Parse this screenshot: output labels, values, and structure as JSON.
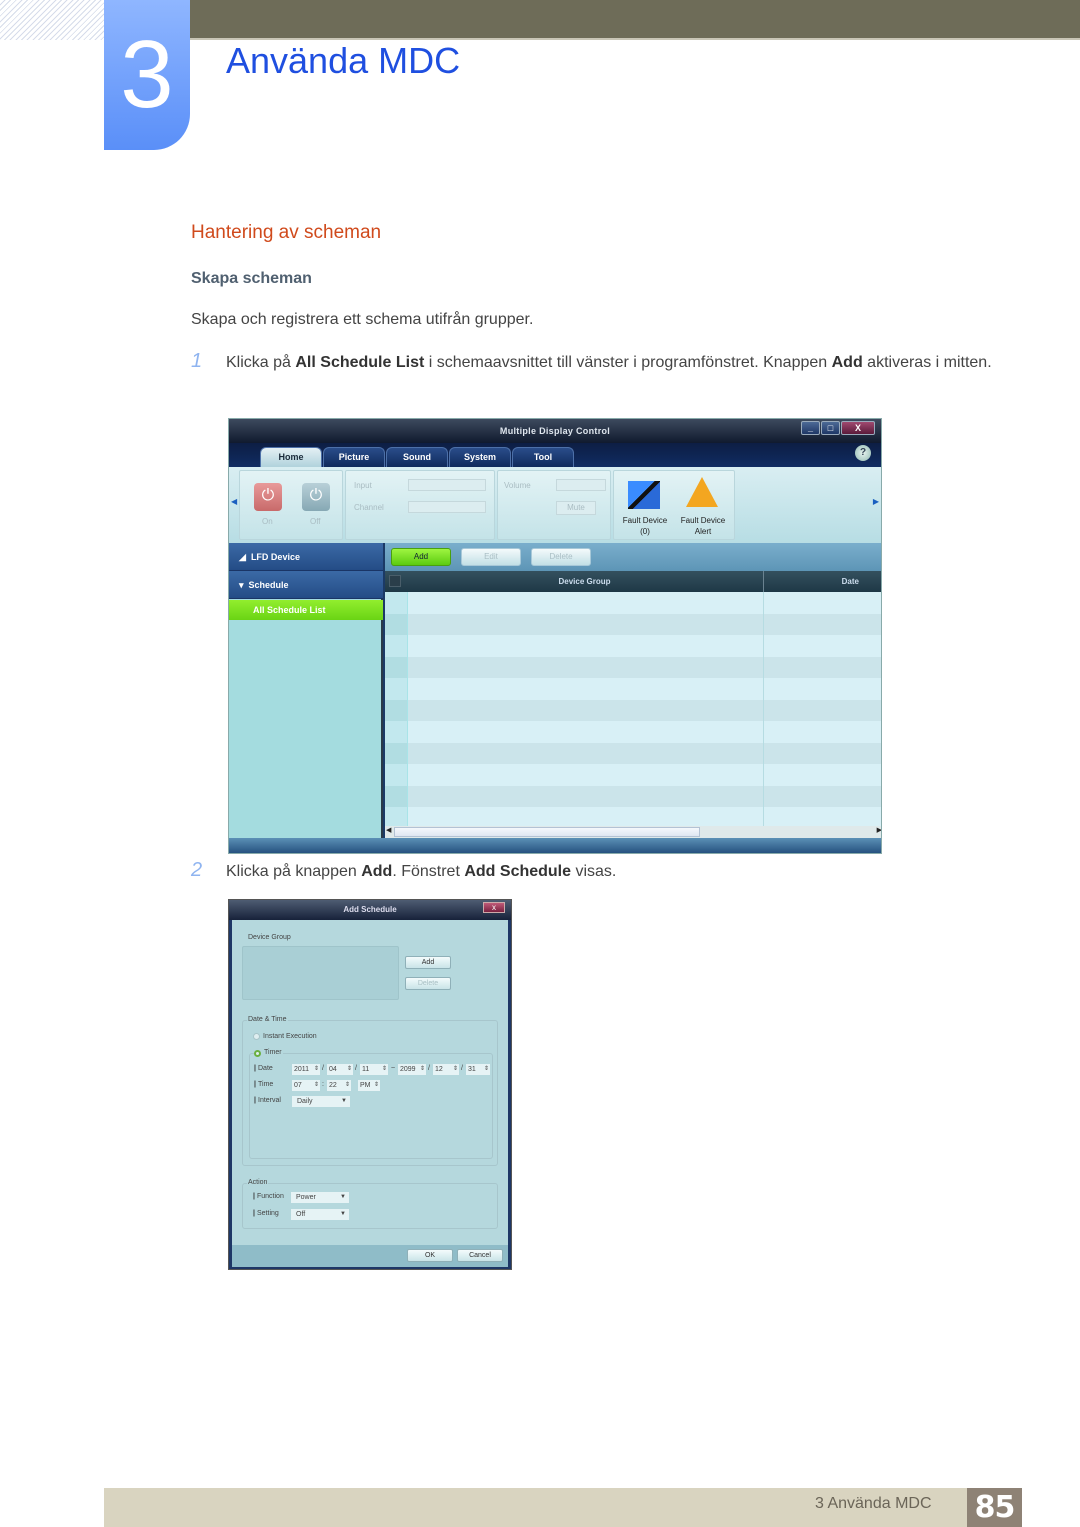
{
  "chapter": {
    "number": "3",
    "title": "Använda MDC"
  },
  "section_title": "Hantering av scheman",
  "subsection_title": "Skapa scheman",
  "intro": "Skapa och registrera ett schema utifrån grupper.",
  "steps": [
    {
      "num": "1",
      "pre": "Klicka på ",
      "b1": "All Schedule List",
      "mid": " i schemaavsnittet till vänster i programfönstret. Knappen ",
      "b2": "Add",
      "post": " aktiveras i mitten."
    },
    {
      "num": "2",
      "pre": "Klicka på knappen ",
      "b1": "Add",
      "mid": ". Fönstret ",
      "b2": "Add Schedule",
      "post": " visas."
    }
  ],
  "mdc_window": {
    "title": "Multiple Display Control",
    "window_controls": {
      "minimize": "_",
      "maximize": "□",
      "close": "X"
    },
    "tabs": [
      "Home",
      "Picture",
      "Sound",
      "System",
      "Tool"
    ],
    "active_tab": "Home",
    "help": "?",
    "ribbon": {
      "on_label": "On",
      "off_label": "Off",
      "input_label": "Input",
      "channel_label": "Channel",
      "volume_label": "Volume",
      "mute_label": "Mute",
      "fault_device": "Fault Device",
      "fault_device_count": "(0)",
      "fault_alert_1": "Fault Device",
      "fault_alert_2": "Alert"
    },
    "sidebar": {
      "lfd": "LFD Device",
      "schedule": "Schedule",
      "all_schedule": "All Schedule List"
    },
    "toolbar": {
      "add": "Add",
      "edit": "Edit",
      "delete": "Delete"
    },
    "grid_columns": [
      "Device Group",
      "Date"
    ],
    "grid_rows": 11
  },
  "add_schedule": {
    "title": "Add Schedule",
    "close": "x",
    "device_group_label": "Device Group",
    "add": "Add",
    "delete": "Delete",
    "date_time_label": "Date & Time",
    "instant_execution": "Instant Execution",
    "timer": "Timer",
    "date_label": "Date",
    "date_start": {
      "year": "2011",
      "month": "04",
      "day": "11"
    },
    "date_sep": "~",
    "date_end": {
      "year": "2099",
      "month": "12",
      "day": "31"
    },
    "time_label": "Time",
    "time": {
      "hour": "07",
      "minute": "22",
      "ampm": "PM"
    },
    "interval_label": "Interval",
    "interval": "Daily",
    "action_label": "Action",
    "function_label": "Function",
    "function": "Power",
    "setting_label": "Setting",
    "setting": "Off",
    "ok": "OK",
    "cancel": "Cancel"
  },
  "footer": {
    "chapter_ref": "3 Använda MDC",
    "page": "85"
  }
}
